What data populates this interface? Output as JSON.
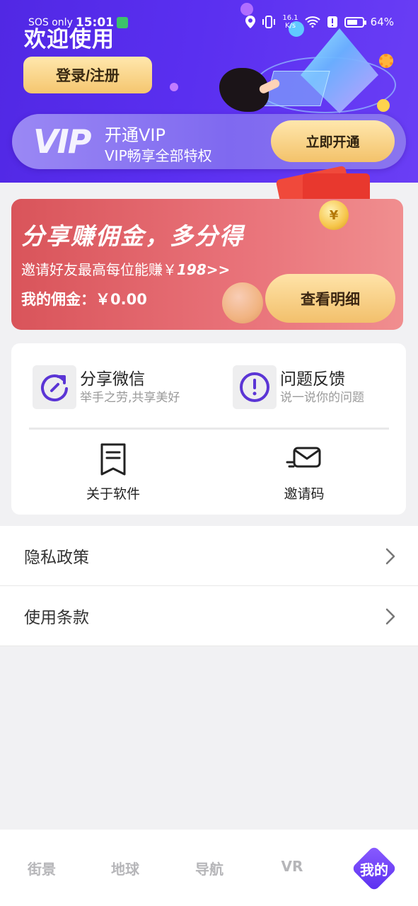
{
  "status_bar": {
    "carrier": "SOS only",
    "time": "15:01",
    "net_speed_top": "16.1",
    "net_speed_bottom": "K/s",
    "battery": "64%"
  },
  "header": {
    "welcome": "欢迎使用",
    "login_button": "登录/注册"
  },
  "vip": {
    "logo": "VIP",
    "title": "开通VIP",
    "subtitle": "VIP畅享全部特权",
    "button": "立即开通"
  },
  "promo": {
    "title": "分享赚佣金，多分得",
    "invite_text": "邀请好友最高每位能赚￥",
    "invite_amount": "198>>",
    "commission": "我的佣金：￥0.00",
    "button": "查看明细",
    "coin_symbol": "¥"
  },
  "menu": {
    "share": {
      "title": "分享微信",
      "subtitle": "举手之劳,共享美好"
    },
    "feedback": {
      "title": "问题反馈",
      "subtitle": "说一说你的问题"
    },
    "about": {
      "label": "关于软件"
    },
    "invite_code": {
      "label": "邀请码"
    }
  },
  "list": {
    "items": [
      {
        "label": "隐私政策"
      },
      {
        "label": "使用条款"
      }
    ]
  },
  "bottom_nav": {
    "items": [
      {
        "label": "街景"
      },
      {
        "label": "地球"
      },
      {
        "label": "导航"
      },
      {
        "label": "VR"
      },
      {
        "label": "我的"
      }
    ],
    "active_index": 4
  },
  "colors": {
    "header_purple": "#5a2ff0",
    "accent_purple": "#5b35d5",
    "gold_button": "#f5c66f",
    "promo_red": "#e0636a"
  }
}
